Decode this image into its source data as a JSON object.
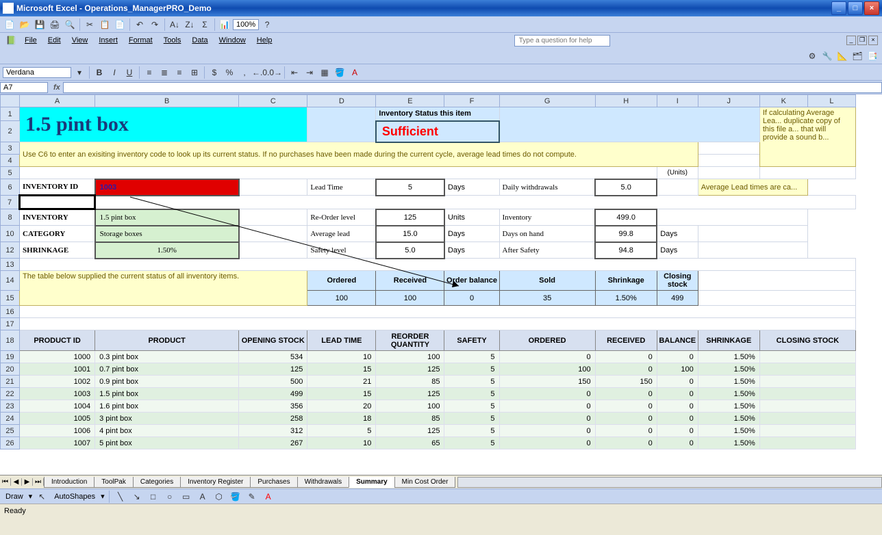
{
  "window": {
    "title": "Microsoft Excel - Operations_ManagerPRO_Demo"
  },
  "menubar": [
    "File",
    "Edit",
    "View",
    "Insert",
    "Format",
    "Tools",
    "Data",
    "Window",
    "Help"
  ],
  "help_placeholder": "Type a question for help",
  "zoom": "100%",
  "font": "Verdana",
  "namebox": "A7",
  "columns": [
    "",
    "A",
    "B",
    "C",
    "D",
    "E",
    "F",
    "G",
    "H",
    "I",
    "J",
    "K",
    "L"
  ],
  "row_numbers": [
    "1",
    "2",
    "3",
    "4",
    "5",
    "6",
    "7",
    "8",
    "10",
    "12",
    "13",
    "14",
    "15",
    "16",
    "17",
    "18",
    "19",
    "20",
    "21",
    "22",
    "23",
    "24",
    "25",
    "26"
  ],
  "dashboard": {
    "title": "1.5 pint box",
    "status_label": "Inventory Status this item",
    "status_value": "Sufficient",
    "hint": "Use C6 to enter an exisiting inventory code to look up its current status. If no purchases have been made during the current cycle, average lead times do not compute.",
    "side_note1": "If calculating Average Lea... duplicate copy of this file a... that will provide a sound b...",
    "side_note2": "Average Lead times are ca...",
    "units_label": "(Units)",
    "fields": {
      "inventory_id_label": "INVENTORY ID",
      "inventory_id": "1003",
      "lead_time_label": "Lead Time",
      "lead_time": "5",
      "lead_time_unit": "Days",
      "daily_withdrawals_label": "Daily withdrawals",
      "daily_withdrawals": "5.0",
      "inventory_label": "INVENTORY",
      "inventory_name": "1.5 pint box",
      "reorder_label": "Re-Order level",
      "reorder": "125",
      "reorder_unit": "Units",
      "inventory_qty_label": "Inventory",
      "inventory_qty": "499.0",
      "category_label": "CATEGORY",
      "category": "Storage boxes",
      "avg_lead_label": "Average lead",
      "avg_lead": "15.0",
      "avg_lead_unit": "Days",
      "days_on_hand_label": "Days on hand",
      "days_on_hand": "99.8",
      "days_on_hand_unit": "Days",
      "shrinkage_label": "SHRINKAGE",
      "shrinkage": "1.50%",
      "safety_label": "Safety level",
      "safety": "5.0",
      "safety_unit": "Days",
      "after_safety_label": "After Safety",
      "after_safety": "94.8",
      "after_safety_unit": "Days"
    },
    "summary_headers": [
      "Ordered",
      "Received",
      "Order balance",
      "Sold",
      "Shrinkage",
      "Closing stock"
    ],
    "summary_values": [
      "100",
      "100",
      "0",
      "35",
      "1.50%",
      "499"
    ],
    "table_note": "The table below supplied the current status of all inventory items."
  },
  "product_table": {
    "headers": [
      "PRODUCT ID",
      "PRODUCT",
      "OPENING STOCK",
      "LEAD TIME",
      "REORDER QUANTITY",
      "SAFETY",
      "ORDERED",
      "RECEIVED",
      "BALANCE",
      "SHRINKAGE",
      "CLOSING STOCK"
    ],
    "rows": [
      {
        "id": "1000",
        "product": "0.3 pint box",
        "opening": "534",
        "lead": "10",
        "reorder": "100",
        "safety": "5",
        "ordered": "0",
        "received": "0",
        "balance": "0",
        "shrinkage": "1.50%"
      },
      {
        "id": "1001",
        "product": "0.7 pint box",
        "opening": "125",
        "lead": "15",
        "reorder": "125",
        "safety": "5",
        "ordered": "100",
        "received": "0",
        "balance": "100",
        "shrinkage": "1.50%"
      },
      {
        "id": "1002",
        "product": "0.9 pint box",
        "opening": "500",
        "lead": "21",
        "reorder": "85",
        "safety": "5",
        "ordered": "150",
        "received": "150",
        "balance": "0",
        "shrinkage": "1.50%"
      },
      {
        "id": "1003",
        "product": "1.5 pint box",
        "opening": "499",
        "lead": "15",
        "reorder": "125",
        "safety": "5",
        "ordered": "0",
        "received": "0",
        "balance": "0",
        "shrinkage": "1.50%"
      },
      {
        "id": "1004",
        "product": "1.6 pint box",
        "opening": "356",
        "lead": "20",
        "reorder": "100",
        "safety": "5",
        "ordered": "0",
        "received": "0",
        "balance": "0",
        "shrinkage": "1.50%"
      },
      {
        "id": "1005",
        "product": "3 pint box",
        "opening": "258",
        "lead": "18",
        "reorder": "85",
        "safety": "5",
        "ordered": "0",
        "received": "0",
        "balance": "0",
        "shrinkage": "1.50%"
      },
      {
        "id": "1006",
        "product": "4 pint box",
        "opening": "312",
        "lead": "5",
        "reorder": "125",
        "safety": "5",
        "ordered": "0",
        "received": "0",
        "balance": "0",
        "shrinkage": "1.50%"
      },
      {
        "id": "1007",
        "product": "5 pint box",
        "opening": "267",
        "lead": "10",
        "reorder": "65",
        "safety": "5",
        "ordered": "0",
        "received": "0",
        "balance": "0",
        "shrinkage": "1.50%"
      }
    ]
  },
  "sheet_tabs": [
    "Introduction",
    "ToolPak",
    "Categories",
    "Inventory Register",
    "Purchases",
    "Withdrawals",
    "Summary",
    "Min Cost Order"
  ],
  "active_tab": "Summary",
  "draw_label": "Draw",
  "autoshapes_label": "AutoShapes",
  "status": "Ready"
}
